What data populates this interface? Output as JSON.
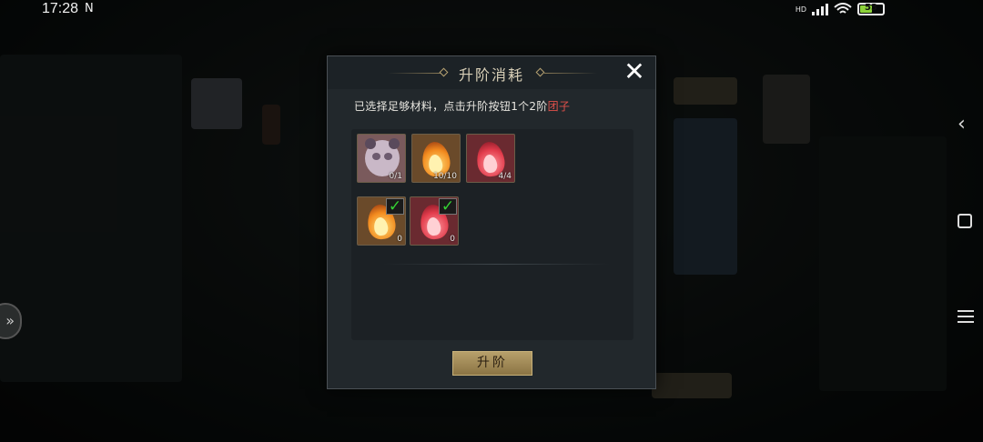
{
  "status_bar": {
    "time": "17:28",
    "notification": "N",
    "network": "HD",
    "battery": "53"
  },
  "modal": {
    "title": "升阶消耗",
    "description_prefix": "已选择足够材料，点击升阶按钮1个2阶",
    "description_highlight": "团子",
    "upgrade_button": "升阶",
    "required_items": [
      {
        "icon": "panda-portrait-icon",
        "count": "0/1"
      },
      {
        "icon": "orange-flame-icon",
        "count": "10/10"
      },
      {
        "icon": "red-flame-icon",
        "count": "4/4"
      }
    ],
    "selected_items": [
      {
        "icon": "orange-flame-icon",
        "count": "0",
        "checked": true
      },
      {
        "icon": "red-flame-icon",
        "count": "0",
        "checked": true
      }
    ]
  },
  "colors": {
    "modal_bg": "#22282c",
    "title": "#d8cfb7",
    "highlight": "#e0504a",
    "check": "#34d233",
    "button": "#a48c5a"
  }
}
